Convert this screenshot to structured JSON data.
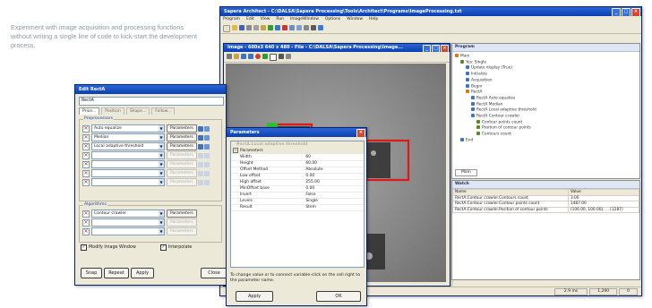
{
  "intro_text": "Experiment with image acquisition and processing functions without writing a single line of code to kick-start the development process.",
  "main_window": {
    "title": "Sapera Architect - C:\\DALSA\\Sapera Processing\\Tools\\Architect\\Programs\\ImageProcessing.txt",
    "menu": [
      "Program",
      "Edit",
      "View",
      "Run",
      "ImageWindow",
      "Options",
      "Window",
      "Help"
    ]
  },
  "image_window": {
    "title": "Image - 600x3 640 x 480 - File - C:\\DALSA\\Sapera Processing\\Image..."
  },
  "program_panel": {
    "title": "Program",
    "items": [
      {
        "label": "Main",
        "indent": 0,
        "icon": "#d07a1c"
      },
      {
        "label": "Yes: Single",
        "indent": 1,
        "icon": "#5a8a2e"
      },
      {
        "label": "Update display (True)",
        "indent": 2,
        "icon": "#3b74c9"
      },
      {
        "label": "Initialize",
        "indent": 2,
        "icon": "#3b74c9"
      },
      {
        "label": "Acquisition",
        "indent": 2,
        "icon": "#3b74c9"
      },
      {
        "label": "Begin",
        "indent": 2,
        "icon": "#3b74c9"
      },
      {
        "label": "RectA",
        "indent": 2,
        "icon": "#d07a1c"
      },
      {
        "label": "RectA Auto equalize",
        "indent": 3,
        "icon": "#3b74c9"
      },
      {
        "label": "RectA Median",
        "indent": 3,
        "icon": "#3b74c9"
      },
      {
        "label": "RectA Local adaptive threshold",
        "indent": 3,
        "icon": "#3b74c9"
      },
      {
        "label": "RectA Contour crawler",
        "indent": 3,
        "icon": "#3b74c9"
      },
      {
        "label": "Contour points count",
        "indent": 4,
        "icon": "#5a8a2e"
      },
      {
        "label": "Position of contour points",
        "indent": 4,
        "icon": "#5a8a2e"
      },
      {
        "label": "Contours count",
        "indent": 4,
        "icon": "#5a8a2e"
      },
      {
        "label": "End",
        "indent": 1,
        "icon": "#3b74c9"
      }
    ],
    "tab": "Main"
  },
  "watch_panel": {
    "title": "Watch",
    "headers": [
      "Name",
      "Value"
    ],
    "rows": [
      {
        "name": "RectA.Contour crawler.Contours count",
        "value": "3.00"
      },
      {
        "name": "RectA.Contour crawler.Contour points count",
        "value": "1487.00"
      },
      {
        "name": "RectA.Contour crawler.Position of contour points",
        "value": "(106.00, 100.00), ... [1287]"
      }
    ]
  },
  "status_bar": [
    "2.9 ms",
    "1,290",
    "0"
  ],
  "edit_dialog": {
    "title": "Edit RectA",
    "name_value": "RectA",
    "tabs": [
      "Price...",
      "Position",
      "Shape...",
      "Follow..."
    ],
    "preprocessors_label": "Preprocessors",
    "preprocessors": [
      {
        "value": "Auto equalize",
        "button": "Parameters",
        "enabled": true
      },
      {
        "value": "Median",
        "button": "Parameters",
        "enabled": true
      },
      {
        "value": "Local adaptive threshold",
        "button": "Parameters",
        "enabled": true
      },
      {
        "value": "",
        "button": "Parameters",
        "enabled": false
      },
      {
        "value": "",
        "button": "Parameters",
        "enabled": false
      },
      {
        "value": "",
        "button": "Parameters",
        "enabled": false
      },
      {
        "value": "",
        "button": "Parameters",
        "enabled": false
      }
    ],
    "algorithms_label": "Algorithms",
    "algorithms": [
      {
        "value": "Contour crawler",
        "button": "Parameters",
        "enabled": true
      },
      {
        "value": "",
        "button": "Parameters",
        "enabled": false
      },
      {
        "value": "",
        "button": "Parameters",
        "enabled": false
      }
    ],
    "modify_label": "Modify Image Window",
    "interpolate_label": "Interpolate",
    "buttons": {
      "snap": "Snap",
      "repeat": "Repeat",
      "apply": "Apply",
      "close": "Close"
    }
  },
  "params_dialog": {
    "title": "Parameters",
    "header": "RectA.Local adaptive threshold",
    "group": "Parameters",
    "rows": [
      {
        "name": "Width",
        "value": "60"
      },
      {
        "name": "Height",
        "value": "60.00"
      },
      {
        "name": "Offset Method",
        "value": "Absolute"
      },
      {
        "name": "Low offset",
        "value": "0.00"
      },
      {
        "name": "High offset",
        "value": "255.00"
      },
      {
        "name": "MinOffset base",
        "value": "0.00"
      },
      {
        "name": "Invert",
        "value": "False"
      },
      {
        "name": "Levels",
        "value": "Single"
      },
      {
        "name": "Result",
        "value": "Stem"
      }
    ],
    "help": "To change value or to connect variable-click on the cell right to the parameter name.",
    "apply": "Apply",
    "ok": "OK"
  },
  "colors": {
    "title_blue": "#0a3fb0",
    "xp_face": "#ece9d8",
    "image_gray": "#8e8e8e",
    "overlay_red": "#e01818",
    "label_green": "#2fbf2f",
    "intro_text": "#8a9aa6"
  }
}
